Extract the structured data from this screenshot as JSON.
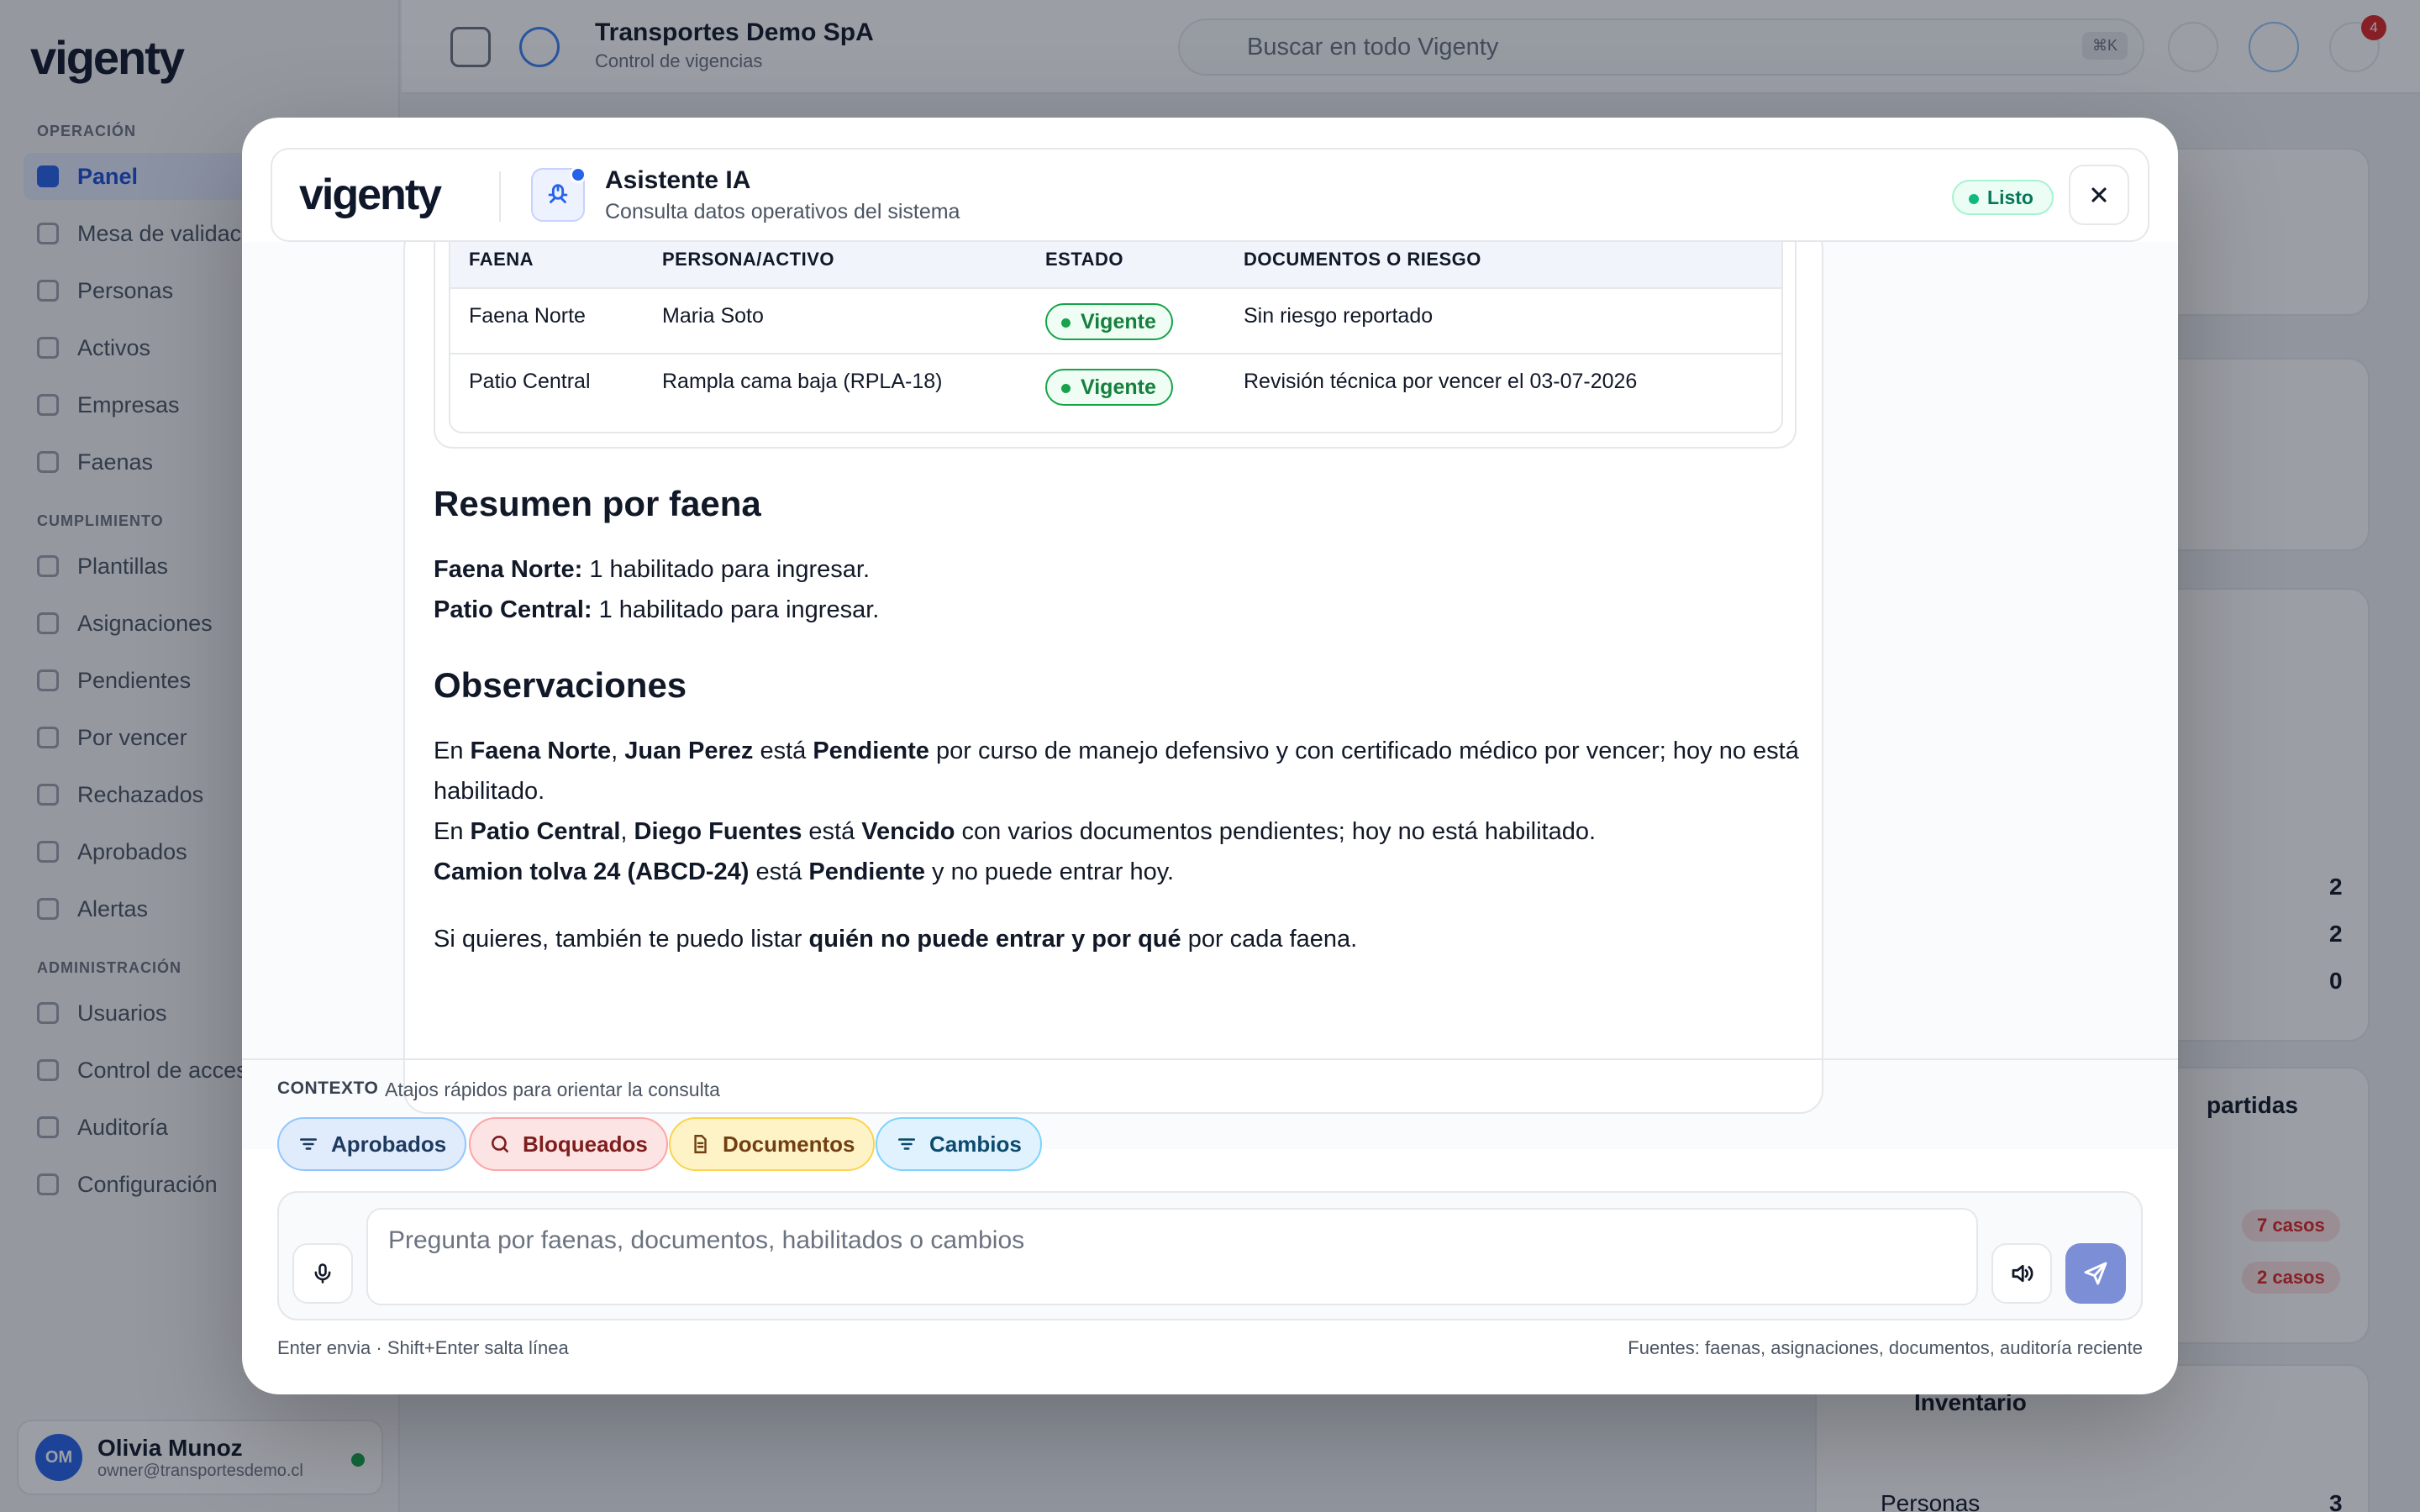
{
  "background": {
    "logo": "vigenty",
    "sections": {
      "operacion": "OPERACIÓN",
      "cumplimiento": "CUMPLIMIENTO",
      "administracion": "ADMINISTRACIÓN"
    },
    "nav": {
      "panel": "Panel",
      "mesa": "Mesa de validación",
      "personas": "Personas",
      "activos": "Activos",
      "empresas": "Empresas",
      "faenas": "Faenas",
      "plantillas": "Plantillas",
      "asignaciones": "Asignaciones",
      "pendientes": "Pendientes",
      "por_vencer": "Por vencer",
      "rechazados": "Rechazados",
      "aprobados": "Aprobados",
      "alertas": "Alertas",
      "usuarios": "Usuarios",
      "control_acceso": "Control de acceso",
      "auditoria": "Auditoría",
      "configuracion": "Configuración"
    },
    "user": {
      "initials": "OM",
      "name": "Olivia Munoz",
      "email": "owner@transportesdemo.cl"
    },
    "org": {
      "title": "Transportes Demo SpA",
      "subtitle": "Control de vigencias"
    },
    "search": {
      "placeholder": "Buscar en todo Vigenty",
      "shortcut": "⌘K"
    },
    "notifications_count": "4",
    "cards": {
      "partidas": "partidas",
      "n1": "2",
      "n2": "2",
      "n3": "0",
      "casos1": "7 casos",
      "casos2": "2 casos",
      "inventario": "Inventario",
      "personas": "Personas",
      "personas_count": "3"
    }
  },
  "modal": {
    "logo": "vigenty",
    "title": "Asistente IA",
    "subtitle": "Consulta datos operativos del sistema",
    "status": "Listo",
    "table": {
      "headers": [
        "FAENA",
        "PERSONA/ACTIVO",
        "ESTADO",
        "DOCUMENTOS O RIESGO"
      ],
      "rows": [
        [
          "Faena Norte",
          "Maria Soto",
          "Vigente",
          "Sin riesgo reportado"
        ],
        [
          "Patio Central",
          "Rampla cama baja (RPLA-18)",
          "Vigente",
          "Revisión técnica por vencer el 03-07-2026"
        ]
      ]
    },
    "resumen": {
      "heading": "Resumen por faena",
      "line1_bold": "Faena Norte:",
      "line1_text": " 1 habilitado para ingresar.",
      "line2_bold": "Patio Central:",
      "line2_text": " 1 habilitado para ingresar."
    },
    "observaciones": {
      "heading": "Observaciones",
      "o1": {
        "a": "En ",
        "b": "Faena Norte",
        "c": ", ",
        "d": "Juan Perez",
        "e": " está ",
        "f": "Pendiente",
        "g": " por curso de manejo defensivo y con certificado médico por vencer; hoy no está habilitado."
      },
      "o2": {
        "a": "En ",
        "b": "Patio Central",
        "c": ", ",
        "d": "Diego Fuentes",
        "e": " está ",
        "f": "Vencido",
        "g": " con varios documentos pendientes; hoy no está habilitado."
      },
      "o3": {
        "b": "Camion tolva 24 (ABCD-24)",
        "e": " está ",
        "f": "Pendiente",
        "g": " y no puede entrar hoy."
      }
    },
    "closing": {
      "a": "Si quieres, también te puedo listar ",
      "b": "quién no puede entrar y por qué",
      "c": " por cada faena."
    },
    "context": {
      "label": "CONTEXTO",
      "hint": "Atajos rápidos para orientar la consulta",
      "chips": [
        "Aprobados",
        "Bloqueados",
        "Documentos",
        "Cambios"
      ]
    },
    "composer": {
      "placeholder": "Pregunta por faenas, documentos, habilitados o cambios",
      "value": ""
    },
    "footer": {
      "hint": "Enter envia · Shift+Enter salta línea",
      "sources": "Fuentes: faenas, asignaciones, documentos, auditoría reciente"
    }
  },
  "colors": {
    "accent": "#2563eb",
    "success": "#16a34a",
    "danger": "#dc2626",
    "send": "#7c8fd6"
  },
  "icons": [
    "sidebar-toggle-icon",
    "org-icon",
    "search-icon",
    "moon-icon",
    "ai-icon",
    "bell-icon",
    "ai-assistant-icon",
    "close-icon",
    "filter-icon",
    "search-icon",
    "document-icon",
    "filter-icon",
    "microphone-icon",
    "speaker-icon",
    "send-icon"
  ]
}
